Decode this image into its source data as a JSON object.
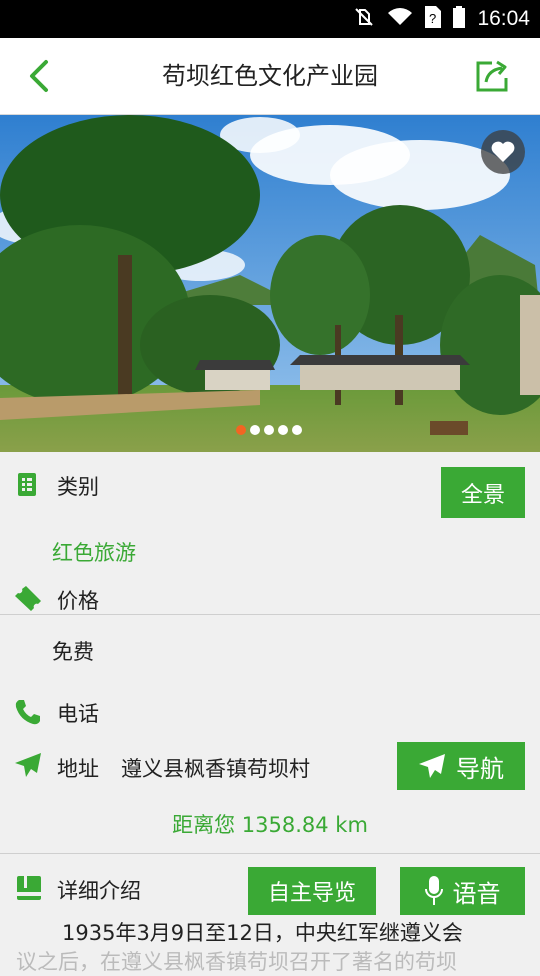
{
  "status_bar": {
    "time": "16:04"
  },
  "header": {
    "title": "苟坝红色文化产业园"
  },
  "banner": {
    "dot_count": 5,
    "active_dot": 0
  },
  "category": {
    "label": "类别",
    "value": "红色旅游",
    "panorama_button": "全景"
  },
  "price": {
    "label": "价格",
    "value": "免费"
  },
  "phone": {
    "label": "电话"
  },
  "address": {
    "label": "地址",
    "value": "遵义县枫香镇苟坝村",
    "navigate_button": "导航"
  },
  "distance": {
    "text": "距离您 1358.84 km"
  },
  "intro": {
    "label": "详细介绍",
    "guide_button": "自主导览",
    "voice_button": "语音",
    "text": "1935年3月9日至12日，中央红军继遵义会",
    "text_next": "议之后，在遵义县枫香镇苟坝召开了著名的苟坝"
  },
  "colors": {
    "accent": "#3aa935",
    "active_dot": "#f26522"
  }
}
